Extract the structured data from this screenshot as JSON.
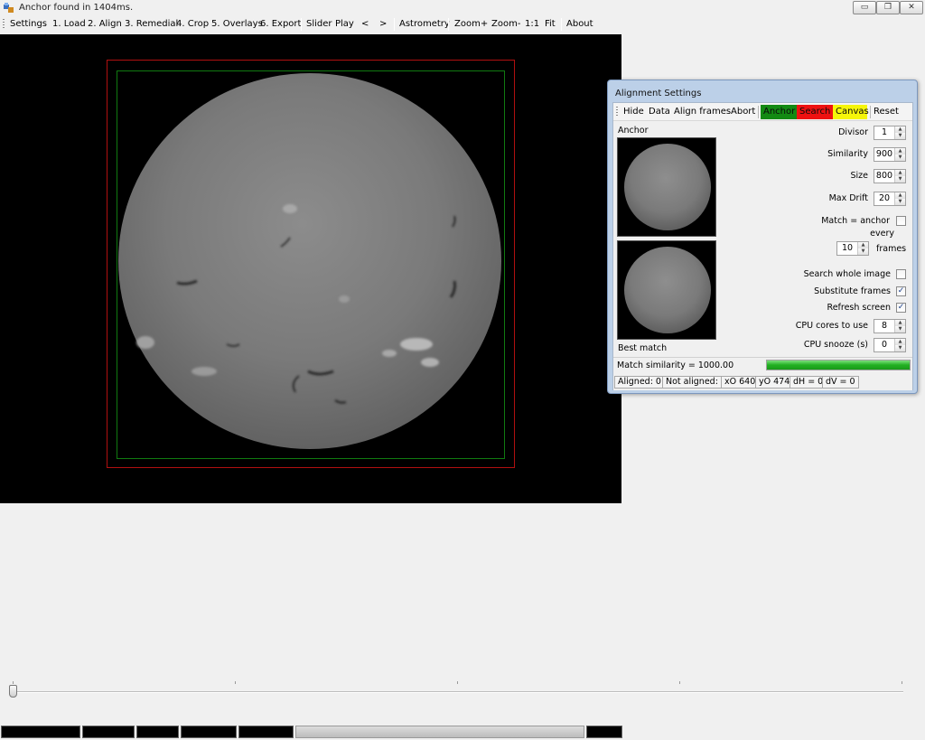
{
  "window": {
    "title": "Anchor found in 1404ms.",
    "min_glyph": "▭",
    "max_glyph": "❐",
    "close_glyph": "✕"
  },
  "menu": {
    "items": [
      "Settings",
      "1. Load",
      "2. Align",
      "3. Remedial",
      "4. Crop",
      "5. Overlays",
      "6. Export",
      "Slider",
      "Play",
      "<",
      ">",
      "Astrometry",
      "Zoom+",
      "Zoom-",
      "1:1",
      "Fit",
      "About"
    ]
  },
  "colors": {
    "anchor_box": "#b01010",
    "search_box": "#107a10",
    "anchor_btn": "#138a13",
    "search_btn": "#ee1111",
    "canvas_btn": "#f5f50a",
    "progress_fill": "#22b022"
  },
  "panel": {
    "title": "Alignment Settings",
    "toolbar": {
      "hide": "Hide",
      "data": "Data",
      "align_frames": "Align frames",
      "abort": "Abort",
      "anchor": "Anchor",
      "search": "Search",
      "canvas": "Canvas",
      "reset": "Reset"
    },
    "anchor_label": "Anchor",
    "best_match_label": "Best match",
    "fields": {
      "divisor": {
        "label": "Divisor",
        "value": "1"
      },
      "similarity": {
        "label": "Similarity",
        "value": "900"
      },
      "size": {
        "label": "Size",
        "value": "800"
      },
      "max_drift": {
        "label": "Max Drift",
        "value": "20"
      },
      "match_anchor_label": "Match = anchor",
      "every_label": "every",
      "frames_value": "10",
      "frames_label": "frames",
      "search_whole_image": "Search whole image",
      "substitute_frames": "Substitute frames",
      "refresh_screen": "Refresh screen",
      "cpu_cores": {
        "label": "CPU cores to use",
        "value": "8"
      },
      "cpu_snooze": {
        "label": "CPU snooze (s)",
        "value": "0"
      }
    },
    "checks": {
      "match_anchor": false,
      "search_whole_image": false,
      "substitute_frames": true,
      "refresh_screen": true
    },
    "match_similarity": "Match similarity = 1000.00",
    "match_similarity_fraction": 1.0,
    "status": {
      "aligned": "Aligned: 0",
      "not_aligned": "Not aligned: 0",
      "xo": "xO 640",
      "yo": "yO 474",
      "dh": "dH = 0",
      "dv": "dV = 0"
    }
  },
  "icons": {
    "app": "app-icon",
    "spin_up": "▲",
    "spin_down": "▼",
    "check": "✓"
  },
  "timeline": {
    "position_fraction": 0.0
  }
}
